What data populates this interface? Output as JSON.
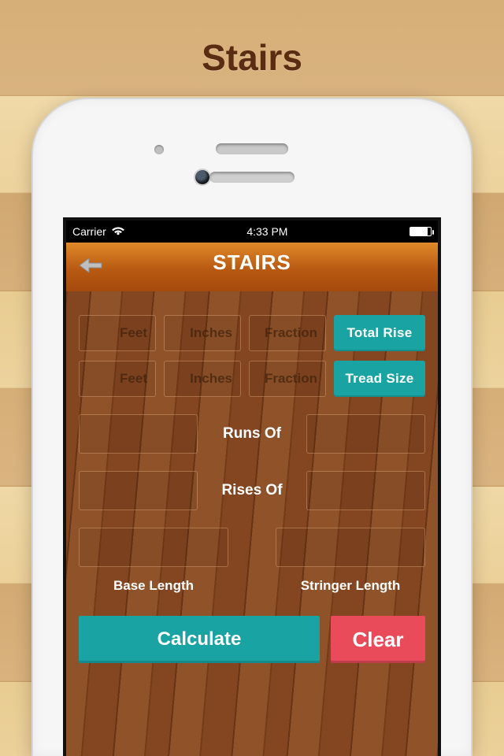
{
  "page_title": "Stairs",
  "statusbar": {
    "carrier": "Carrier",
    "time": "4:33 PM"
  },
  "header": {
    "title": "STAIRS"
  },
  "inputs": {
    "row1": {
      "feet": "Feet",
      "inches": "Inches",
      "fraction": "Fraction",
      "label": "Total Rise"
    },
    "row2": {
      "feet": "Feet",
      "inches": "Inches",
      "fraction": "Fraction",
      "label": "Tread Size"
    }
  },
  "mid": {
    "runs_of": "Runs Of",
    "rises_of": "Rises Of"
  },
  "bottom": {
    "base_length": "Base Length",
    "stringer_length": "Stringer Length"
  },
  "actions": {
    "calculate": "Calculate",
    "clear": "Clear"
  }
}
